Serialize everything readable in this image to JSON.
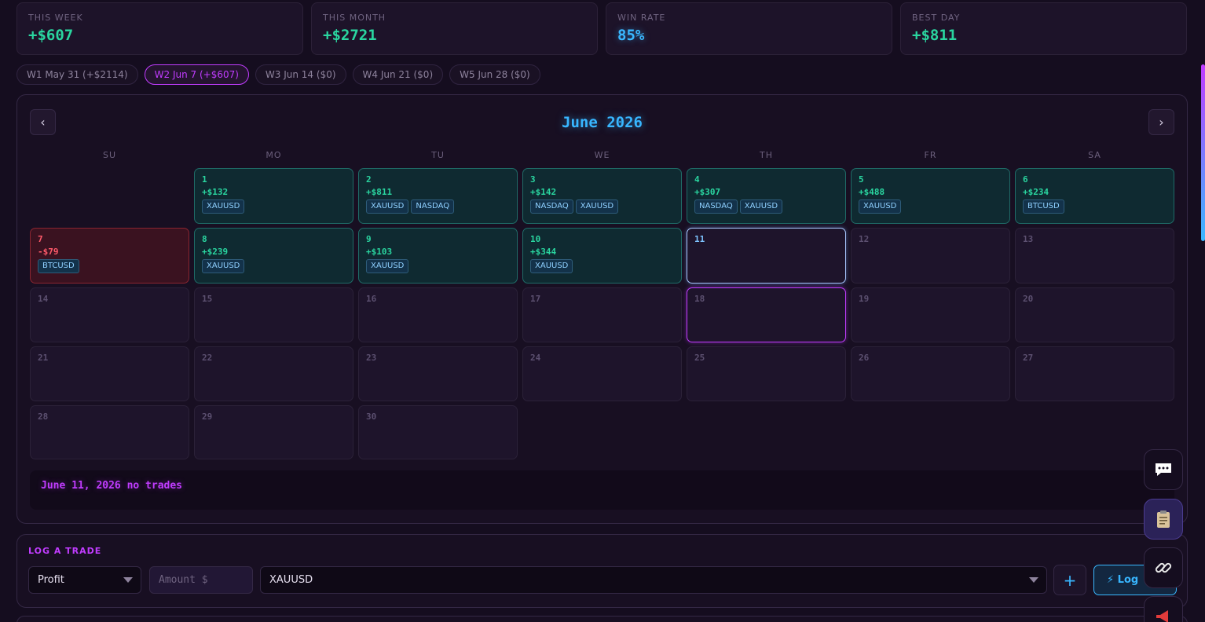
{
  "stats": [
    {
      "label": "THIS WEEK",
      "value": "+$607",
      "tone": "green"
    },
    {
      "label": "THIS MONTH",
      "value": "+$2721",
      "tone": "green"
    },
    {
      "label": "WIN RATE",
      "value": "85%",
      "tone": "blue"
    },
    {
      "label": "BEST DAY",
      "value": "+$811",
      "tone": "green"
    }
  ],
  "week_tabs": [
    {
      "label": "W1 May 31 (+$2114)",
      "active": false
    },
    {
      "label": "W2 Jun 7 (+$607)",
      "active": true
    },
    {
      "label": "W3 Jun 14 ($0)",
      "active": false
    },
    {
      "label": "W4 Jun 21 ($0)",
      "active": false
    },
    {
      "label": "W5 Jun 28 ($0)",
      "active": false
    }
  ],
  "calendar": {
    "title": "June 2026",
    "prev_label": "‹",
    "next_label": "›",
    "weekdays": [
      "SU",
      "MO",
      "TU",
      "WE",
      "TH",
      "FR",
      "SA"
    ],
    "days": [
      {
        "num": "",
        "state": "empty"
      },
      {
        "num": "1",
        "pnl": "+$132",
        "tags": [
          "XAUUSD"
        ],
        "state": "win"
      },
      {
        "num": "2",
        "pnl": "+$811",
        "tags": [
          "XAUUSD",
          "NASDAQ"
        ],
        "state": "win"
      },
      {
        "num": "3",
        "pnl": "+$142",
        "tags": [
          "NASDAQ",
          "XAUUSD"
        ],
        "state": "win"
      },
      {
        "num": "4",
        "pnl": "+$307",
        "tags": [
          "NASDAQ",
          "XAUUSD"
        ],
        "state": "win"
      },
      {
        "num": "5",
        "pnl": "+$488",
        "tags": [
          "XAUUSD"
        ],
        "state": "win"
      },
      {
        "num": "6",
        "pnl": "+$234",
        "tags": [
          "BTCUSD"
        ],
        "state": "win"
      },
      {
        "num": "7",
        "pnl": "-$79",
        "tags": [
          "BTCUSD"
        ],
        "state": "loss"
      },
      {
        "num": "8",
        "pnl": "+$239",
        "tags": [
          "XAUUSD"
        ],
        "state": "win"
      },
      {
        "num": "9",
        "pnl": "+$103",
        "tags": [
          "XAUUSD"
        ],
        "state": "win"
      },
      {
        "num": "10",
        "pnl": "+$344",
        "tags": [
          "XAUUSD"
        ],
        "state": "win"
      },
      {
        "num": "11",
        "state": "today"
      },
      {
        "num": "12",
        "state": "none"
      },
      {
        "num": "13",
        "state": "none"
      },
      {
        "num": "14",
        "state": "none"
      },
      {
        "num": "15",
        "state": "none"
      },
      {
        "num": "16",
        "state": "none"
      },
      {
        "num": "17",
        "state": "none"
      },
      {
        "num": "18",
        "state": "selected"
      },
      {
        "num": "19",
        "state": "none"
      },
      {
        "num": "20",
        "state": "none"
      },
      {
        "num": "21",
        "state": "none"
      },
      {
        "num": "22",
        "state": "none"
      },
      {
        "num": "23",
        "state": "none"
      },
      {
        "num": "24",
        "state": "none"
      },
      {
        "num": "25",
        "state": "none"
      },
      {
        "num": "26",
        "state": "none"
      },
      {
        "num": "27",
        "state": "none"
      },
      {
        "num": "28",
        "state": "none"
      },
      {
        "num": "29",
        "state": "none"
      },
      {
        "num": "30",
        "state": "none"
      }
    ],
    "note": "June 11, 2026 no trades"
  },
  "log_trade": {
    "title": "LOG A TRADE",
    "type_value": "Profit",
    "amount_placeholder": "Amount $",
    "symbol_value": "XAUUSD",
    "add_label": "+",
    "log_label": "⚡ Log"
  },
  "fabs": [
    {
      "name": "chat-icon",
      "glyph": "💬"
    },
    {
      "name": "clipboard-icon",
      "glyph": "📋"
    },
    {
      "name": "link-icon",
      "glyph": "🔗"
    },
    {
      "name": "megaphone-icon",
      "glyph": "📣"
    }
  ],
  "colors": {
    "accent_green": "#2ad6a0",
    "accent_blue": "#38b6ff",
    "accent_purple": "#c13cff",
    "loss_red": "#ff5a6a",
    "background": "#150d1f"
  }
}
